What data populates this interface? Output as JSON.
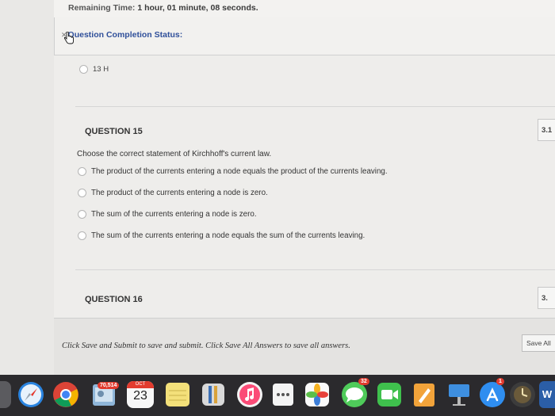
{
  "timer": {
    "label": "Remaining Time:",
    "value": "1 hour, 01 minute, 08 seconds."
  },
  "status": {
    "label": "Question Completion Status:"
  },
  "previous_question": {
    "last_choice": "13 H"
  },
  "questions": [
    {
      "title": "QUESTION 15",
      "points": "3.1",
      "prompt": "Choose the correct statement of Kirchhoff's current law.",
      "choices": [
        "The product of the currents entering a node equals the product of the currents leaving.",
        "The product of the currents entering a node is zero.",
        "The sum of the currents entering a node is zero.",
        "The sum of the currents entering a node equals the sum of the currents leaving."
      ]
    },
    {
      "title": "QUESTION 16",
      "points": "3."
    }
  ],
  "footer": {
    "instructions": "Click Save and Submit to save and submit. Click Save All Answers to save all answers.",
    "save_all_label": "Save All"
  },
  "dock": {
    "icons": [
      "safari-icon",
      "chrome-icon",
      "preview-icon",
      "calendar-icon",
      "notes-icon",
      "tools-icon",
      "music-icon",
      "dots-icon",
      "photos-icon",
      "messages-icon",
      "facetime-icon",
      "pages-icon",
      "keynote-icon",
      "app-store-icon",
      "time-machine-icon",
      "word-icon"
    ],
    "preview_badge": "70,514",
    "calendar_month": "OCT",
    "calendar_day": "23",
    "messages_badge": "32",
    "app_store_badge": "1",
    "word_letter": "W"
  }
}
